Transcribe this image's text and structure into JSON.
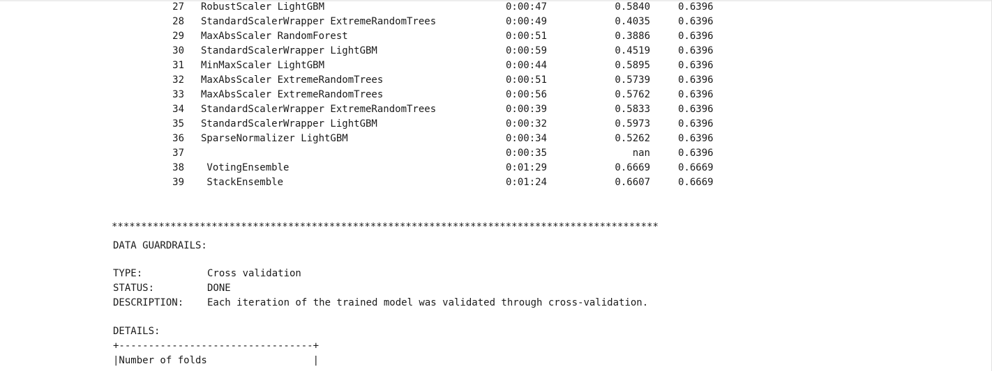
{
  "runs": [
    {
      "iteration": "27",
      "pipeline": "RobustScaler LightGBM",
      "duration": "0:00:47",
      "metric": "0.5840",
      "best": "0.6396"
    },
    {
      "iteration": "28",
      "pipeline": "StandardScalerWrapper ExtremeRandomTrees",
      "duration": "0:00:49",
      "metric": "0.4035",
      "best": "0.6396"
    },
    {
      "iteration": "29",
      "pipeline": "MaxAbsScaler RandomForest",
      "duration": "0:00:51",
      "metric": "0.3886",
      "best": "0.6396"
    },
    {
      "iteration": "30",
      "pipeline": "StandardScalerWrapper LightGBM",
      "duration": "0:00:59",
      "metric": "0.4519",
      "best": "0.6396"
    },
    {
      "iteration": "31",
      "pipeline": "MinMaxScaler LightGBM",
      "duration": "0:00:44",
      "metric": "0.5895",
      "best": "0.6396"
    },
    {
      "iteration": "32",
      "pipeline": "MaxAbsScaler ExtremeRandomTrees",
      "duration": "0:00:51",
      "metric": "0.5739",
      "best": "0.6396"
    },
    {
      "iteration": "33",
      "pipeline": "MaxAbsScaler ExtremeRandomTrees",
      "duration": "0:00:56",
      "metric": "0.5762",
      "best": "0.6396"
    },
    {
      "iteration": "34",
      "pipeline": "StandardScalerWrapper ExtremeRandomTrees",
      "duration": "0:00:39",
      "metric": "0.5833",
      "best": "0.6396"
    },
    {
      "iteration": "35",
      "pipeline": "StandardScalerWrapper LightGBM",
      "duration": "0:00:32",
      "metric": "0.5973",
      "best": "0.6396"
    },
    {
      "iteration": "36",
      "pipeline": "SparseNormalizer LightGBM",
      "duration": "0:00:34",
      "metric": "0.5262",
      "best": "0.6396"
    },
    {
      "iteration": "37",
      "pipeline": "",
      "duration": "0:00:35",
      "metric": "nan",
      "best": "0.6396"
    },
    {
      "iteration": "38",
      "pipeline": " VotingEnsemble",
      "duration": "0:01:29",
      "metric": "0.6669",
      "best": "0.6669"
    },
    {
      "iteration": "39",
      "pipeline": " StackEnsemble",
      "duration": "0:01:24",
      "metric": "0.6607",
      "best": "0.6669"
    }
  ],
  "guardrails": {
    "separator": "*********************************************************************************************",
    "heading": "DATA GUARDRAILS:",
    "type_label": "TYPE:",
    "type_value": "Cross validation",
    "status_label": "STATUS:",
    "status_value": "DONE",
    "description_label": "DESCRIPTION:",
    "description_value": "Each iteration of the trained model was validated through cross-validation.",
    "details_label": "DETAILS:",
    "table_border": "+---------------------------------+",
    "table_row_text": "|Number of folds                  |"
  }
}
